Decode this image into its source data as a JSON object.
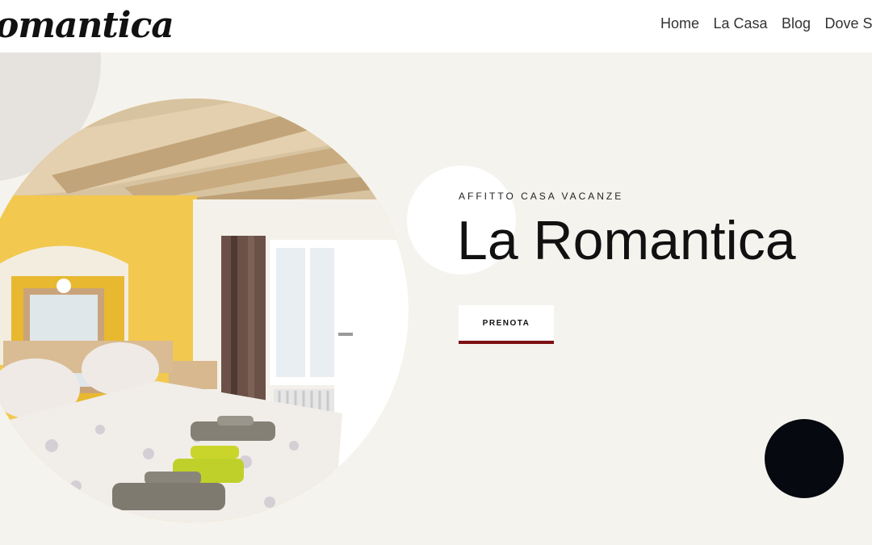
{
  "header": {
    "logo_text": "omantica",
    "nav": [
      "Home",
      "La Casa",
      "Blog",
      "Dove Sia"
    ]
  },
  "hero": {
    "kicker": "AFFITTO CASA VACANZE",
    "title": "La Romantica",
    "cta_label": "PRENOTA",
    "accent_color": "#7d1013",
    "background_color": "#f5f3ee",
    "image_subject": "bedroom with double bed, towels, yellow wall, mirror, window with curtain"
  }
}
